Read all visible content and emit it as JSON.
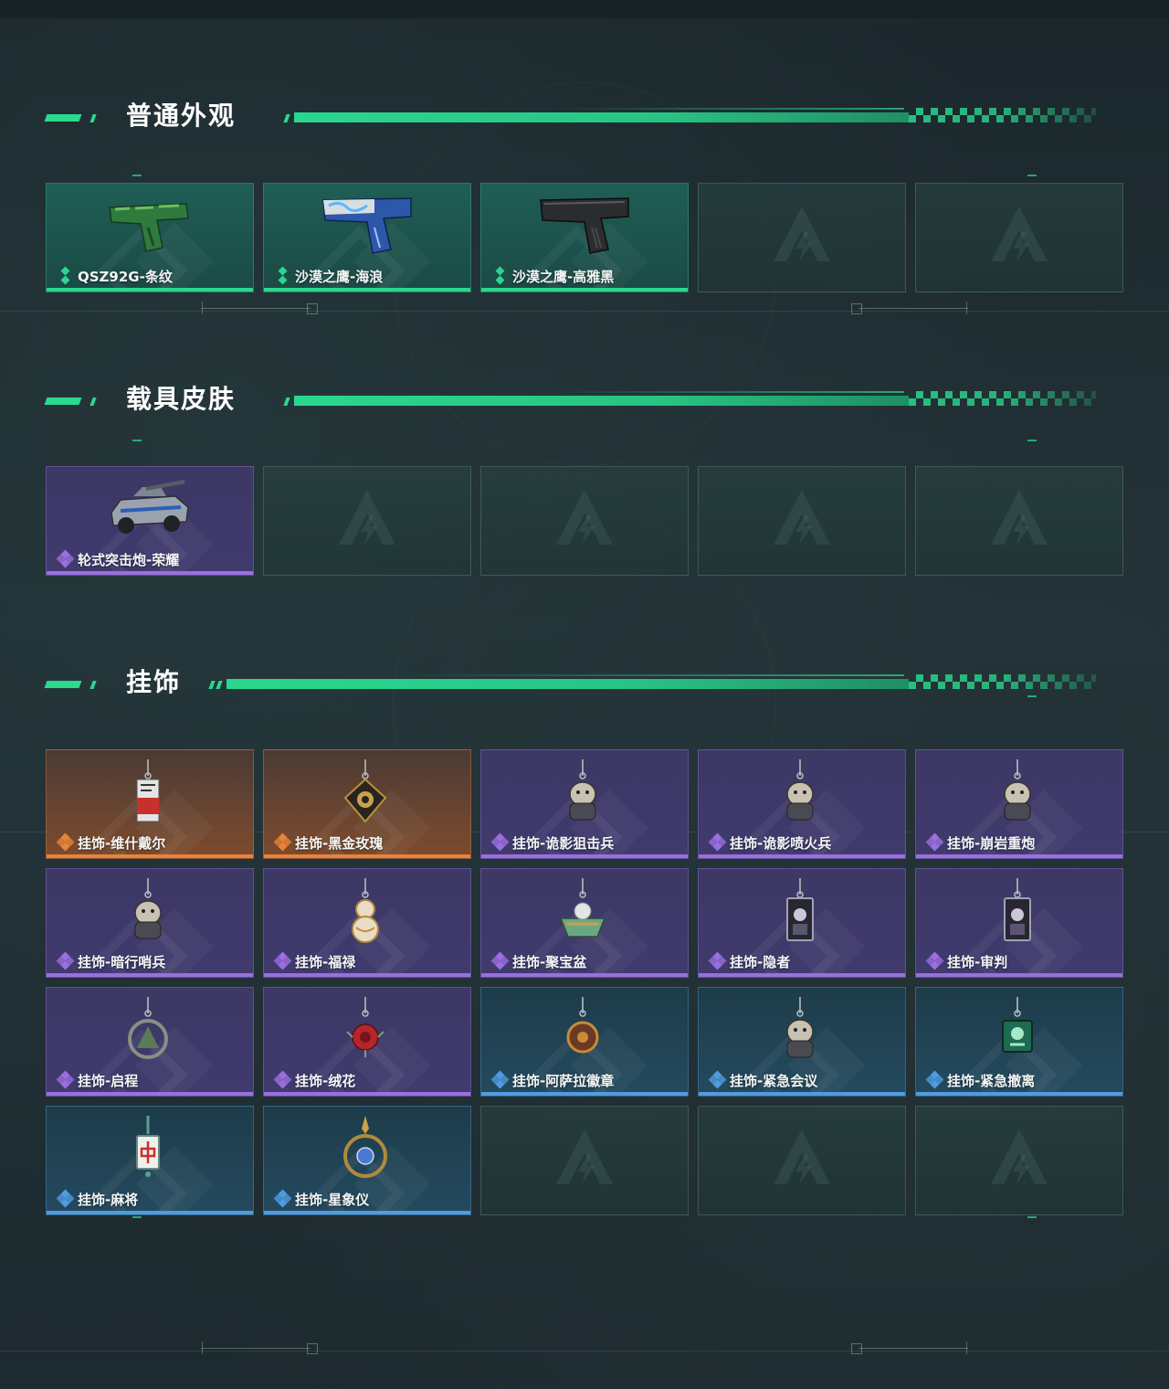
{
  "sections": [
    {
      "title": "普通外观",
      "items": [
        {
          "label": "QSZ92G-条纹",
          "rarity": "green",
          "art": "pistol-green"
        },
        {
          "label": "沙漠之鹰-海浪",
          "rarity": "green",
          "art": "pistol-blue"
        },
        {
          "label": "沙漠之鹰-高雅黑",
          "rarity": "green",
          "art": "pistol-black"
        },
        {
          "label": "",
          "rarity": "empty"
        },
        {
          "label": "",
          "rarity": "empty"
        }
      ]
    },
    {
      "title": "载具皮肤",
      "items": [
        {
          "label": "轮式突击炮-荣耀",
          "rarity": "purple",
          "art": "vehicle"
        },
        {
          "label": "",
          "rarity": "empty"
        },
        {
          "label": "",
          "rarity": "empty"
        },
        {
          "label": "",
          "rarity": "empty"
        },
        {
          "label": "",
          "rarity": "empty"
        }
      ]
    },
    {
      "title": "挂饰",
      "items": [
        {
          "label": "挂饰-维什戴尔",
          "rarity": "orange",
          "art": "charm-tag"
        },
        {
          "label": "挂饰-黑金玫瑰",
          "rarity": "orange",
          "art": "charm-rose-gold"
        },
        {
          "label": "挂饰-诡影狙击兵",
          "rarity": "purple",
          "art": "charm-figure"
        },
        {
          "label": "挂饰-诡影喷火兵",
          "rarity": "purple",
          "art": "charm-figure"
        },
        {
          "label": "挂饰-崩岩重炮",
          "rarity": "purple",
          "art": "charm-figure"
        },
        {
          "label": "挂饰-暗行哨兵",
          "rarity": "purple",
          "art": "charm-figure"
        },
        {
          "label": "挂饰-福禄",
          "rarity": "purple",
          "art": "charm-gourd"
        },
        {
          "label": "挂饰-聚宝盆",
          "rarity": "purple",
          "art": "charm-bowl"
        },
        {
          "label": "挂饰-隐者",
          "rarity": "purple",
          "art": "charm-card"
        },
        {
          "label": "挂饰-审判",
          "rarity": "purple",
          "art": "charm-card"
        },
        {
          "label": "挂饰-启程",
          "rarity": "purple",
          "art": "charm-ring"
        },
        {
          "label": "挂饰-绒花",
          "rarity": "purple",
          "art": "charm-flower"
        },
        {
          "label": "挂饰-阿萨拉徽章",
          "rarity": "blue",
          "art": "charm-badge"
        },
        {
          "label": "挂饰-紧急会议",
          "rarity": "blue",
          "art": "charm-figure"
        },
        {
          "label": "挂饰-紧急撤离",
          "rarity": "blue",
          "art": "charm-square"
        },
        {
          "label": "挂饰-麻将",
          "rarity": "blue",
          "art": "charm-mahjong"
        },
        {
          "label": "挂饰-星象仪",
          "rarity": "blue",
          "art": "charm-astro"
        },
        {
          "label": "",
          "rarity": "empty"
        },
        {
          "label": "",
          "rarity": "empty"
        },
        {
          "label": "",
          "rarity": "empty"
        }
      ]
    }
  ],
  "colors": {
    "accent_green": "#2ad790",
    "rarity_green": "#2ad790",
    "rarity_purple": "#9b6fe0",
    "rarity_orange": "#e8843a",
    "rarity_blue": "#4f9ce0"
  }
}
